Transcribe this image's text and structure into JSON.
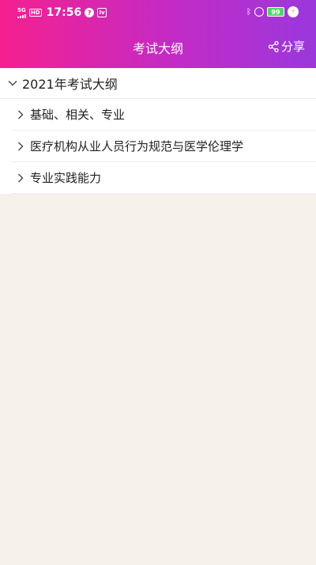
{
  "status_bar": {
    "network": "5G",
    "hd": "HD",
    "time": "17:56",
    "battery": "99",
    "icons": [
      "signal-icon",
      "hd-icon",
      "notification-icon",
      "app-icon",
      "bluetooth-icon",
      "alarm-icon",
      "battery-icon",
      "charging-icon"
    ]
  },
  "header": {
    "title": "考试大纲",
    "share_label": "分享",
    "gradient": [
      "#f5208f",
      "#9a38dc"
    ]
  },
  "tree": {
    "root_label": "2021年考试大纲",
    "items": [
      {
        "label": "基础、相关、专业"
      },
      {
        "label": "医疗机构从业人员行为规范与医学伦理学"
      },
      {
        "label": "专业实践能力"
      }
    ]
  },
  "colors": {
    "background": "#f6f1ea",
    "text": "#222222"
  }
}
